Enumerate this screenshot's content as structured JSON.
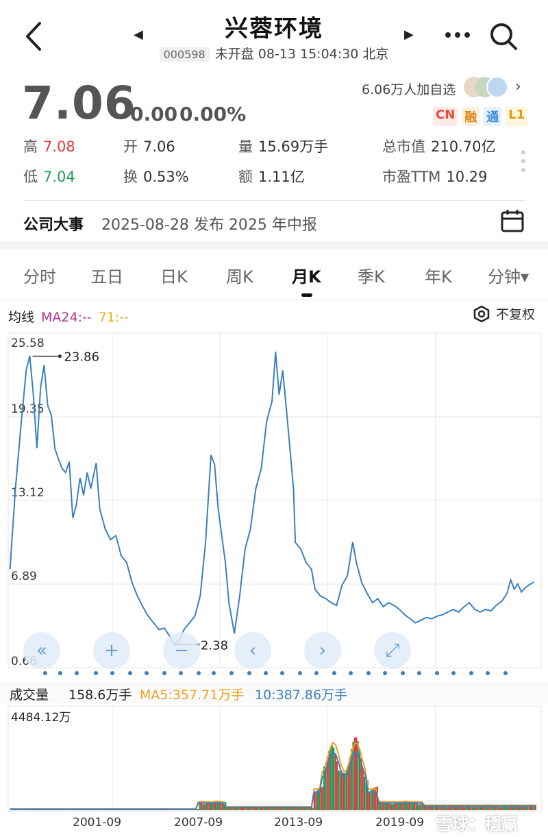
{
  "header": {
    "stock_name": "兴蓉环境",
    "stock_code": "000598",
    "status_line": "未开盘 08-13 15:04:30 北京",
    "prev_arrow": "◀",
    "next_arrow": "▶"
  },
  "quote": {
    "price": "7.06",
    "change": "0.00",
    "change_pct": "0.00%",
    "watchers": "6.06万人加自选",
    "badges": [
      "CN",
      "融",
      "通",
      "L1"
    ]
  },
  "stats": {
    "high_label": "高",
    "high": "7.08",
    "open_label": "开",
    "open": "7.06",
    "volume_label": "量",
    "volume": "15.69万手",
    "mktcap_label": "总市值",
    "mktcap": "210.70亿",
    "low_label": "低",
    "low": "7.04",
    "turnover_label": "换",
    "turnover": "0.53%",
    "amount_label": "额",
    "amount": "1.11亿",
    "pe_label": "市盈TTM",
    "pe": "10.29"
  },
  "event": {
    "label": "公司大事",
    "text": "2025-08-28 发布 2025 年中报"
  },
  "tabs": [
    "分时",
    "五日",
    "日K",
    "周K",
    "月K",
    "季K",
    "年K",
    "分钟▾"
  ],
  "active_tab": "月K",
  "ma": {
    "title": "均线",
    "ma24": "MA24:--",
    "ma71": "71:--",
    "fq_label": "不复权"
  },
  "volume": {
    "title": "成交量",
    "value": "158.6万手",
    "ma5": "MA5:357.71万手",
    "ma10": "10:387.86万手",
    "max_label": "4484.12万"
  },
  "watermark": "雪球：穩赢",
  "colors": {
    "line": "#3a7fc1",
    "up": "#e03a3a",
    "down": "#1f9a5a",
    "ma5": "#f0a020",
    "ma10": "#3a7fc1"
  },
  "chart_data": {
    "type": "line",
    "x_ticks": [
      "2001-09",
      "2007-09",
      "2013-09",
      "2019-09"
    ],
    "y_ticks": [
      25.58,
      19.35,
      13.12,
      6.89,
      0.66
    ],
    "ylim": [
      0.66,
      25.58
    ],
    "annotations": [
      {
        "label": "23.86",
        "x": "1996-1997",
        "y": 23.86
      },
      {
        "label": "2.38",
        "x": "2005",
        "y": 2.38
      }
    ],
    "series": [
      {
        "values": [
          [
            1996.0,
            8.0
          ],
          [
            1996.3,
            14.0
          ],
          [
            1996.6,
            18.5
          ],
          [
            1996.9,
            22.8
          ],
          [
            1997.1,
            23.9
          ],
          [
            1997.3,
            21.0
          ],
          [
            1997.5,
            17.0
          ],
          [
            1997.7,
            21.5
          ],
          [
            1997.9,
            23.2
          ],
          [
            1998.1,
            20.2
          ],
          [
            1998.3,
            19.5
          ],
          [
            1998.5,
            17.0
          ],
          [
            1998.7,
            16.2
          ],
          [
            1998.9,
            15.5
          ],
          [
            1999.1,
            15.2
          ],
          [
            1999.3,
            16.0
          ],
          [
            1999.5,
            11.8
          ],
          [
            1999.7,
            12.8
          ],
          [
            1999.9,
            14.8
          ],
          [
            2000.1,
            13.5
          ],
          [
            2000.3,
            15.2
          ],
          [
            2000.5,
            14.0
          ],
          [
            2000.8,
            15.9
          ],
          [
            2001.0,
            12.5
          ],
          [
            2001.3,
            11.0
          ],
          [
            2001.6,
            10.2
          ],
          [
            2001.9,
            10.5
          ],
          [
            2002.2,
            9.0
          ],
          [
            2002.5,
            8.5
          ],
          [
            2002.8,
            7.0
          ],
          [
            2003.1,
            6.0
          ],
          [
            2003.4,
            5.2
          ],
          [
            2003.7,
            4.5
          ],
          [
            2004.0,
            4.0
          ],
          [
            2004.3,
            3.5
          ],
          [
            2004.6,
            3.6
          ],
          [
            2004.9,
            3.0
          ],
          [
            2005.1,
            2.5
          ],
          [
            2005.4,
            2.6
          ],
          [
            2005.7,
            3.5
          ],
          [
            2006.0,
            4.0
          ],
          [
            2006.3,
            4.5
          ],
          [
            2006.6,
            6.0
          ],
          [
            2006.9,
            10.0
          ],
          [
            2007.2,
            16.5
          ],
          [
            2007.4,
            15.8
          ],
          [
            2007.6,
            12.5
          ],
          [
            2007.8,
            10.5
          ],
          [
            2008.0,
            8.5
          ],
          [
            2008.2,
            5.5
          ],
          [
            2008.5,
            3.2
          ],
          [
            2008.8,
            6.0
          ],
          [
            2009.1,
            9.5
          ],
          [
            2009.4,
            11.0
          ],
          [
            2009.7,
            14.0
          ],
          [
            2010.0,
            15.5
          ],
          [
            2010.3,
            19.0
          ],
          [
            2010.6,
            20.5
          ],
          [
            2010.8,
            24.2
          ],
          [
            2011.0,
            21.0
          ],
          [
            2011.2,
            22.8
          ],
          [
            2011.5,
            18.5
          ],
          [
            2011.8,
            14.0
          ],
          [
            2011.9,
            10.0
          ],
          [
            2012.2,
            9.5
          ],
          [
            2012.5,
            8.5
          ],
          [
            2012.8,
            8.0
          ],
          [
            2013.0,
            6.5
          ],
          [
            2013.3,
            6.0
          ],
          [
            2013.6,
            5.8
          ],
          [
            2013.9,
            5.5
          ],
          [
            2014.2,
            5.3
          ],
          [
            2014.5,
            6.8
          ],
          [
            2014.8,
            7.5
          ],
          [
            2015.1,
            10.0
          ],
          [
            2015.3,
            8.5
          ],
          [
            2015.6,
            7.0
          ],
          [
            2015.9,
            6.2
          ],
          [
            2016.2,
            5.5
          ],
          [
            2016.5,
            5.8
          ],
          [
            2016.8,
            5.2
          ],
          [
            2017.1,
            5.5
          ],
          [
            2017.4,
            5.3
          ],
          [
            2017.7,
            5.0
          ],
          [
            2018.0,
            4.6
          ],
          [
            2018.3,
            4.3
          ],
          [
            2018.6,
            4.0
          ],
          [
            2018.9,
            4.2
          ],
          [
            2019.2,
            4.4
          ],
          [
            2019.5,
            4.3
          ],
          [
            2019.8,
            4.5
          ],
          [
            2020.1,
            4.6
          ],
          [
            2020.4,
            4.8
          ],
          [
            2020.7,
            5.0
          ],
          [
            2021.0,
            4.8
          ],
          [
            2021.3,
            5.2
          ],
          [
            2021.6,
            5.5
          ],
          [
            2021.9,
            5.0
          ],
          [
            2022.2,
            4.8
          ],
          [
            2022.5,
            5.0
          ],
          [
            2022.8,
            4.9
          ],
          [
            2023.1,
            5.3
          ],
          [
            2023.4,
            5.6
          ],
          [
            2023.7,
            6.2
          ],
          [
            2023.9,
            7.2
          ],
          [
            2024.1,
            6.5
          ],
          [
            2024.3,
            6.9
          ],
          [
            2024.5,
            6.3
          ],
          [
            2024.7,
            6.6
          ],
          [
            2024.9,
            6.8
          ],
          [
            2025.2,
            7.06
          ]
        ]
      }
    ]
  }
}
